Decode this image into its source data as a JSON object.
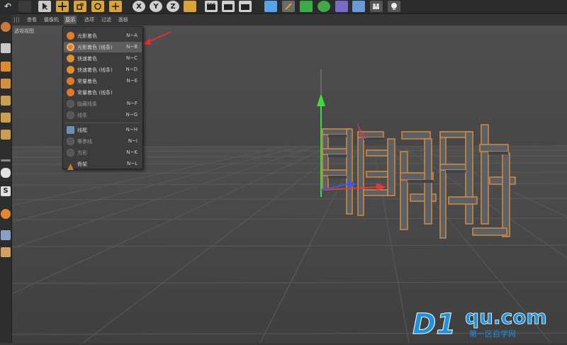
{
  "menubar": {
    "items": [
      {
        "label": "查看",
        "active": false
      },
      {
        "label": "摄像机",
        "active": false
      },
      {
        "label": "显示",
        "active": true
      },
      {
        "label": "选项",
        "active": false
      },
      {
        "label": "过滤",
        "active": false
      },
      {
        "label": "面板",
        "active": false
      }
    ]
  },
  "toolbar": {
    "axis_x": "X",
    "axis_y": "Y",
    "axis_z": "Z"
  },
  "viewport": {
    "label": "透视视图"
  },
  "display_menu": {
    "items": [
      {
        "label": "光影着色",
        "shortcut": "N~A",
        "icon": "shaded-icon",
        "dim": false
      },
      {
        "label": "光影着色 (线条)",
        "shortcut": "N~B",
        "icon": "shaded-lines-icon",
        "dim": false,
        "highlighted": true
      },
      {
        "label": "快速着色",
        "shortcut": "N~C",
        "icon": "quick-shading-icon",
        "dim": false
      },
      {
        "label": "快速着色 (线条)",
        "shortcut": "N~D",
        "icon": "quick-shading-lines-icon",
        "dim": false
      },
      {
        "label": "常量着色",
        "shortcut": "N~E",
        "icon": "constant-shading-icon",
        "dim": false
      },
      {
        "label": "常量着色 (线条)",
        "shortcut": "",
        "icon": "constant-shading-lines-icon",
        "dim": false
      },
      {
        "label": "隐藏线条",
        "shortcut": "N~F",
        "icon": "hidden-line-icon",
        "dim": true
      },
      {
        "label": "线条",
        "shortcut": "N~G",
        "icon": "lines-icon",
        "dim": true
      },
      {
        "label": "线框",
        "shortcut": "N~H",
        "icon": "wireframe-icon",
        "dim": false
      },
      {
        "label": "等参线",
        "shortcut": "N~I",
        "icon": "isoparms-icon",
        "dim": true
      },
      {
        "label": "方形",
        "shortcut": "N~K",
        "icon": "box-icon",
        "dim": true
      },
      {
        "label": "骨架",
        "shortcut": "N~L",
        "icon": "skeleton-icon",
        "dim": false
      }
    ]
  },
  "scene": {
    "text_object": "可读性分析"
  },
  "watermark": {
    "brand": "D1",
    "domain": "qu.com",
    "subtitle": "第一区自学网"
  },
  "colors": {
    "accent_orange": "#e07a2a",
    "axis_green": "#3ddc3d",
    "axis_red": "#e23b3b",
    "axis_blue": "#3b5be2",
    "watermark_blue": "#1f8fe0",
    "annotation_arrow": "#e23030"
  }
}
